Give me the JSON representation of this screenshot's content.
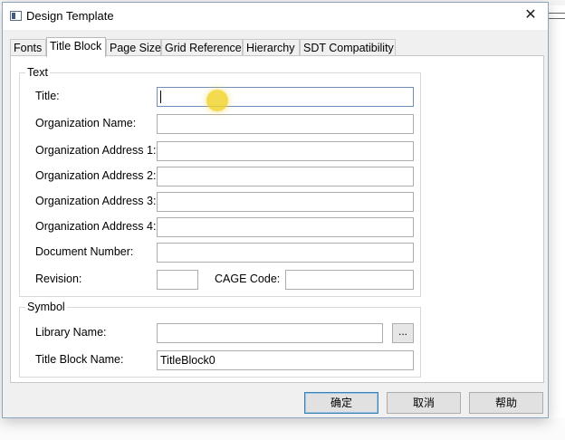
{
  "window": {
    "title": "Design Template",
    "close_symbol": "✕",
    "background_text": "——"
  },
  "tabs": [
    {
      "label": "Fonts",
      "active": false
    },
    {
      "label": "Title Block",
      "active": true
    },
    {
      "label": "Page Size",
      "active": false
    },
    {
      "label": "Grid Reference",
      "active": false
    },
    {
      "label": "Hierarchy",
      "active": false
    },
    {
      "label": "SDT Compatibility",
      "active": false
    }
  ],
  "text_group": {
    "title": "Text",
    "fields": {
      "title": {
        "label": "Title:",
        "value": ""
      },
      "organization_name": {
        "label": "Organization Name:",
        "value": ""
      },
      "org_address_1": {
        "label": "Organization Address 1:",
        "value": ""
      },
      "org_address_2": {
        "label": "Organization Address 2:",
        "value": ""
      },
      "org_address_3": {
        "label": "Organization Address 3:",
        "value": ""
      },
      "org_address_4": {
        "label": "Organization Address 4:",
        "value": ""
      },
      "document_number": {
        "label": "Document Number:",
        "value": ""
      },
      "revision": {
        "label": "Revision:",
        "value": ""
      },
      "cage_code": {
        "label": "CAGE Code:",
        "value": ""
      }
    }
  },
  "symbol_group": {
    "title": "Symbol",
    "library_name": {
      "label": "Library Name:",
      "value": ""
    },
    "browse_button": "...",
    "title_block_name": {
      "label": "Title Block Name:",
      "value": "TitleBlock0"
    }
  },
  "buttons": {
    "ok": "确定",
    "cancel": "取消",
    "help": "帮助"
  },
  "colors": {
    "cursor_highlight": "#f0d228",
    "focus_border": "#6d8fb9",
    "default_button_border": "#3c7fb1"
  },
  "icons": {
    "app": "window-icon",
    "close": "close-icon"
  }
}
